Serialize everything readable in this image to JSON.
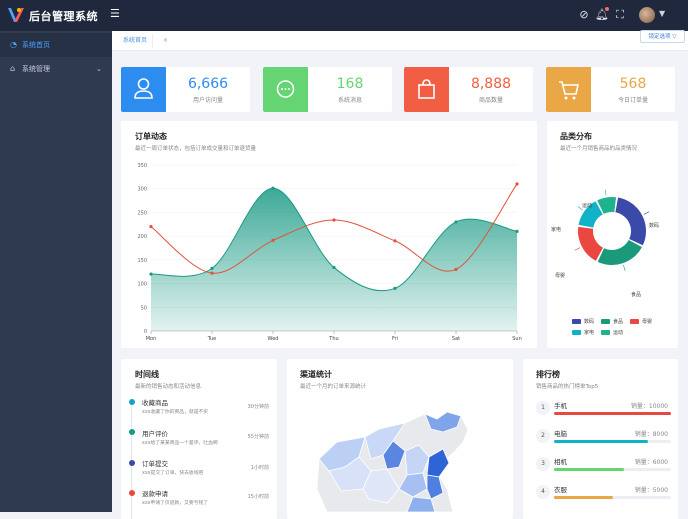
{
  "app": {
    "title": "后台管理系统"
  },
  "sidebar": {
    "items": [
      {
        "label": "系统首页",
        "icon": "gauge-icon"
      },
      {
        "label": "系统管理",
        "icon": "home-icon"
      }
    ]
  },
  "breadcrumb": {
    "tab": "系统首页",
    "close": "×",
    "lock_label": "锁定选项 ▽"
  },
  "stats": [
    {
      "value": "6,666",
      "label": "用户访问量",
      "color": "#2d8cf0",
      "num_color": "#2d8cf0",
      "icon": "user-icon"
    },
    {
      "value": "168",
      "label": "系统消息",
      "color": "#64d572",
      "num_color": "#64d572",
      "icon": "message-icon"
    },
    {
      "value": "8,888",
      "label": "商品数量",
      "color": "#f25e43",
      "num_color": "#f25e43",
      "icon": "bag-icon"
    },
    {
      "value": "568",
      "label": "今日订单量",
      "color": "#e9a745",
      "num_color": "#e9a745",
      "icon": "cart-icon"
    }
  ],
  "order_chart": {
    "title": "订单动态",
    "subtitle": "最近一周订单状态，包括订单成交量和订单退货量"
  },
  "chart_data": [
    {
      "type": "line",
      "categories": [
        "Mon",
        "Tue",
        "Wed",
        "Thu",
        "Fri",
        "Sat",
        "Sun"
      ],
      "ylim": [
        0,
        350
      ],
      "yticks": [
        0,
        50,
        100,
        150,
        200,
        250,
        300,
        350
      ],
      "series": [
        {
          "values": [
            120,
            132,
            301,
            134,
            90,
            230,
            210
          ],
          "color": "#1a9a85",
          "style": "area"
        },
        {
          "values": [
            220,
            122,
            191,
            234,
            190,
            130,
            310
          ],
          "color": "#e0533a",
          "style": "line"
        }
      ],
      "grid": true
    },
    {
      "type": "pie",
      "title": "品类分布",
      "subtitle": "最近一个月销售商品的品类情况",
      "labels": [
        "数码",
        "家电",
        "食品",
        "母婴",
        "运动"
      ],
      "values": [
        30,
        15,
        25,
        20,
        10
      ],
      "colors": [
        "#3a4aa8",
        "#10b2c7",
        "#1a9a7a",
        "#e9473f",
        "#1fb28e"
      ]
    }
  ],
  "category_chart": {
    "title": "品类分布",
    "subtitle": "最近一个月销售商品的品类情况",
    "slice_labels": [
      "数码",
      "食品",
      "母婴",
      "家电",
      "运动"
    ],
    "legend": [
      {
        "label": "数码",
        "color": "#3a4aa8"
      },
      {
        "label": "食品",
        "color": "#1a9a7a"
      },
      {
        "label": "母婴",
        "color": "#e9473f"
      },
      {
        "label": "家电",
        "color": "#10b2c7"
      },
      {
        "label": "运动",
        "color": "#1fb28e"
      }
    ]
  },
  "timeline": {
    "title": "时间线",
    "subtitle": "最新的销售动态和活动信息",
    "items": [
      {
        "title": "收藏商品",
        "desc": "xxx收藏了你的商品，就是不买",
        "time": "30分钟前",
        "color": "#18a0c8"
      },
      {
        "title": "用户评价",
        "desc": "xxx给了某某商品一个差评，吐血啊",
        "time": "55分钟前",
        "color": "#1a9a85"
      },
      {
        "title": "订单提交",
        "desc": "xxx提交了订单，快去收钱吧",
        "time": "1小时前",
        "color": "#3a4aa8"
      },
      {
        "title": "退款申请",
        "desc": "xxx申请了仅退款，又要亏钱了",
        "time": "15小时前",
        "color": "#e9473f"
      }
    ]
  },
  "channel": {
    "title": "渠道统计",
    "subtitle": "最近一个月的订单来源统计"
  },
  "ranking": {
    "title": "排行榜",
    "subtitle": "销售商品的热门榜单Top5",
    "items": [
      {
        "rank": "1",
        "name": "手机",
        "value": "销量：10000",
        "pct": 1.0,
        "color": "#e9473f"
      },
      {
        "rank": "2",
        "name": "电脑",
        "value": "销量：8000",
        "pct": 0.8,
        "color": "#10b2c7"
      },
      {
        "rank": "3",
        "name": "相机",
        "value": "销量：6000",
        "pct": 0.6,
        "color": "#64d572"
      },
      {
        "rank": "4",
        "name": "衣服",
        "value": "销量：5000",
        "pct": 0.5,
        "color": "#e9a745"
      }
    ]
  }
}
